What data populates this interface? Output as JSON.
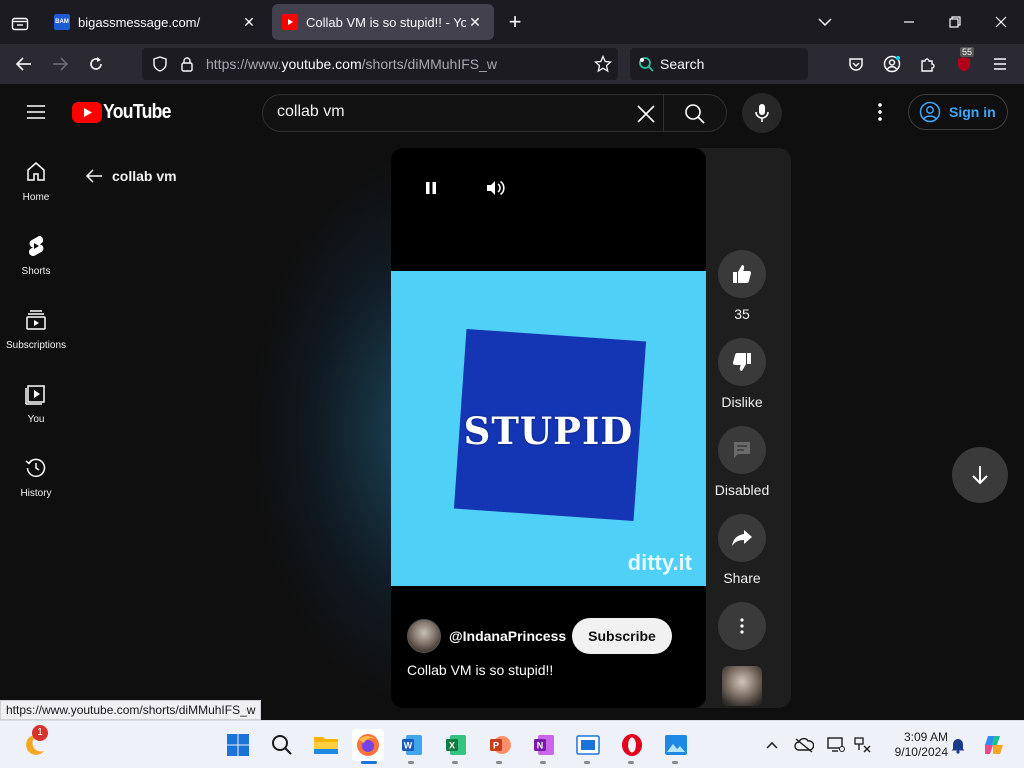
{
  "browser": {
    "tabs": [
      {
        "title": "bigassmessage.com/",
        "favicon_text": "BAM",
        "favicon_color": "#1e5bd6",
        "active": false
      },
      {
        "title": "Collab VM is so stupid!! - YouTube",
        "favicon_color": "#ff0000",
        "active": true
      }
    ],
    "url_prefix": "https://www.",
    "url_host": "youtube.com",
    "url_path": "/shorts/diMMuhIFS_w",
    "search_placeholder": "Search",
    "extension_badge": "55"
  },
  "youtube": {
    "logo_text": "YouTube",
    "search_value": "collab vm",
    "sign_in_label": "Sign in",
    "nav": [
      {
        "label": "Home",
        "icon": "home-icon"
      },
      {
        "label": "Shorts",
        "icon": "shorts-icon"
      },
      {
        "label": "Subscriptions",
        "icon": "subscriptions-icon"
      },
      {
        "label": "You",
        "icon": "you-icon"
      },
      {
        "label": "History",
        "icon": "history-icon"
      }
    ],
    "back_label": "collab vm",
    "short": {
      "overlay_text": "STUPID",
      "watermark": "ditty.it",
      "channel_handle": "@IndanaPrincess",
      "subscribe_label": "Subscribe",
      "caption": "Collab VM is so stupid!!",
      "video_bg_color": "#4fd0f7",
      "card_color": "#1536b4"
    },
    "actions": {
      "like_count": "35",
      "dislike_label": "Dislike",
      "comments_label": "Disabled",
      "share_label": "Share"
    }
  },
  "status_bar_url": "https://www.youtube.com/shorts/diMMuhIFS_w",
  "taskbar": {
    "widget_badge": "1",
    "time": "3:09 AM",
    "date": "9/10/2024",
    "apps": [
      "start-icon",
      "search-icon",
      "file-explorer-icon",
      "firefox-icon",
      "word-icon",
      "excel-icon",
      "powerpoint-icon",
      "onenote-icon",
      "app-window-icon",
      "opera-icon",
      "photos-icon"
    ]
  }
}
